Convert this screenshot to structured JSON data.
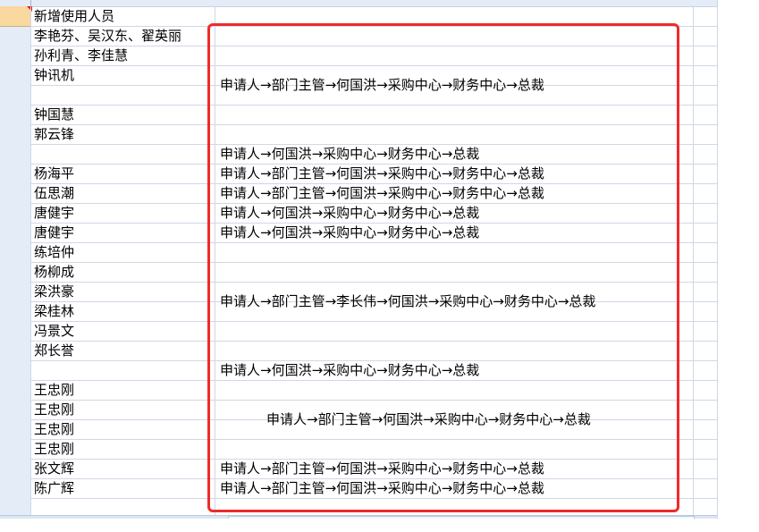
{
  "sheet": {
    "header_cell": "新增使用人员",
    "names": [
      "李艳芬、吴汉东、翟英丽",
      "孙利青、李佳慧",
      "钟讯机",
      "",
      "钟国慧",
      "郭云锋",
      "",
      "杨海平",
      "伍思潮",
      "唐健宇",
      "唐健宇",
      "练培仲",
      "杨柳成",
      "梁洪豪",
      "梁桂林",
      "冯景文",
      "郑长誉",
      "",
      "王忠刚",
      "王忠刚",
      "王忠刚",
      "王忠刚",
      "张文辉",
      "陈广辉"
    ],
    "flows": [
      "申请人→部门主管→何国洪→采购中心→财务中心→总裁",
      "申请人→何国洪→采购中心→财务中心→总裁",
      "申请人→部门主管→何国洪→采购中心→财务中心→总裁",
      "申请人→部门主管→何国洪→采购中心→财务中心→总裁",
      "申请人→何国洪→采购中心→财务中心→总裁",
      "申请人→何国洪→采购中心→财务中心→总裁",
      "申请人→部门主管→李长伟→何国洪→采购中心→财务中心→总裁",
      "申请人→何国洪→采购中心→财务中心→总裁",
      "申请人→部门主管→何国洪→采购中心→财务中心→总裁",
      "申请人→部门主管→何国洪→采购中心→财务中心→总裁",
      "申请人→部门主管→何国洪→采购中心→财务中心→总裁"
    ],
    "colors": {
      "highlight_box": "#ee2b2b",
      "active_row_header": "#f9d99f",
      "grid": "#d0d7e5"
    }
  }
}
